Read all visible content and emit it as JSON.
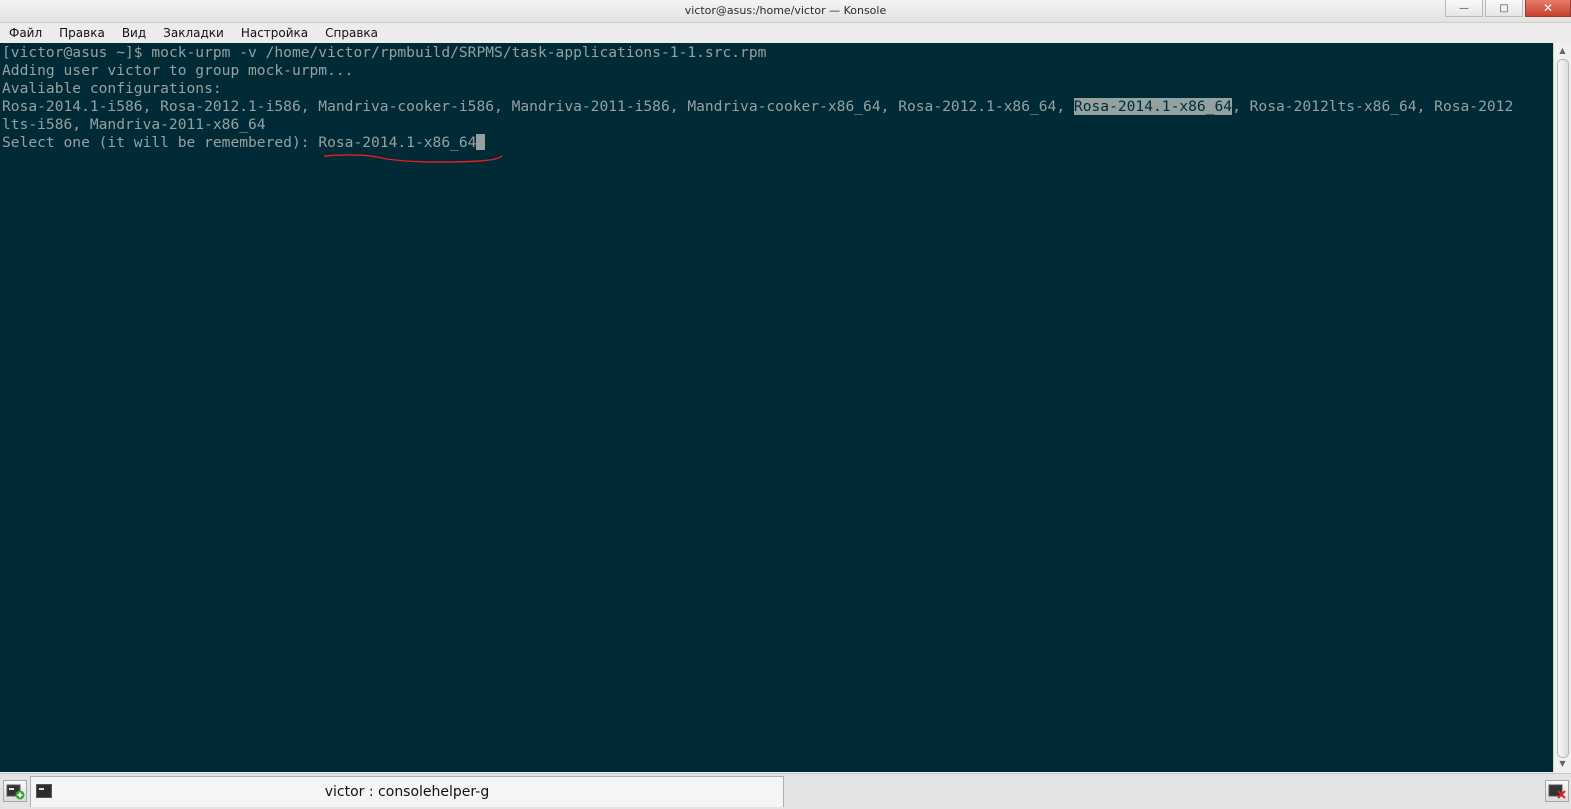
{
  "window": {
    "title": "victor@asus:/home/victor — Konsole",
    "minimize_icon": "minimize-icon",
    "maximize_icon": "maximize-icon",
    "close_icon": "close-icon"
  },
  "menubar": {
    "items": [
      "Файл",
      "Правка",
      "Вид",
      "Закладки",
      "Настройка",
      "Справка"
    ]
  },
  "terminal": {
    "prompt": "[victor@asus ~]$ ",
    "command": "mock-urpm -v /home/victor/rpmbuild/SRPMS/task-applications-1-1.src.rpm",
    "line2": "Adding user victor to group mock-urpm...",
    "line3": "Avaliable configurations:",
    "line4_before": "Rosa-2014.1-i586, Rosa-2012.1-i586, Mandriva-cooker-i586, Mandriva-2011-i586, Mandriva-cooker-x86_64, Rosa-2012.1-x86_64, ",
    "line4_highlight": "Rosa-2014.1-x86_64",
    "line4_after": ", Rosa-2012lts-x86_64, Rosa-2012",
    "line5": "lts-i586, Mandriva-2011-x86_64",
    "line6_prompt": "Select one (it will be remembered): ",
    "line6_input": "Rosa-2014.1-x86_64",
    "annotation_color": "#e02020"
  },
  "tabbar": {
    "new_tab_icon": "new-tab-icon",
    "tab_icon": "terminal-icon",
    "tab_label": "victor : consolehelper-g",
    "close_tab_icon": "close-tab-icon"
  }
}
